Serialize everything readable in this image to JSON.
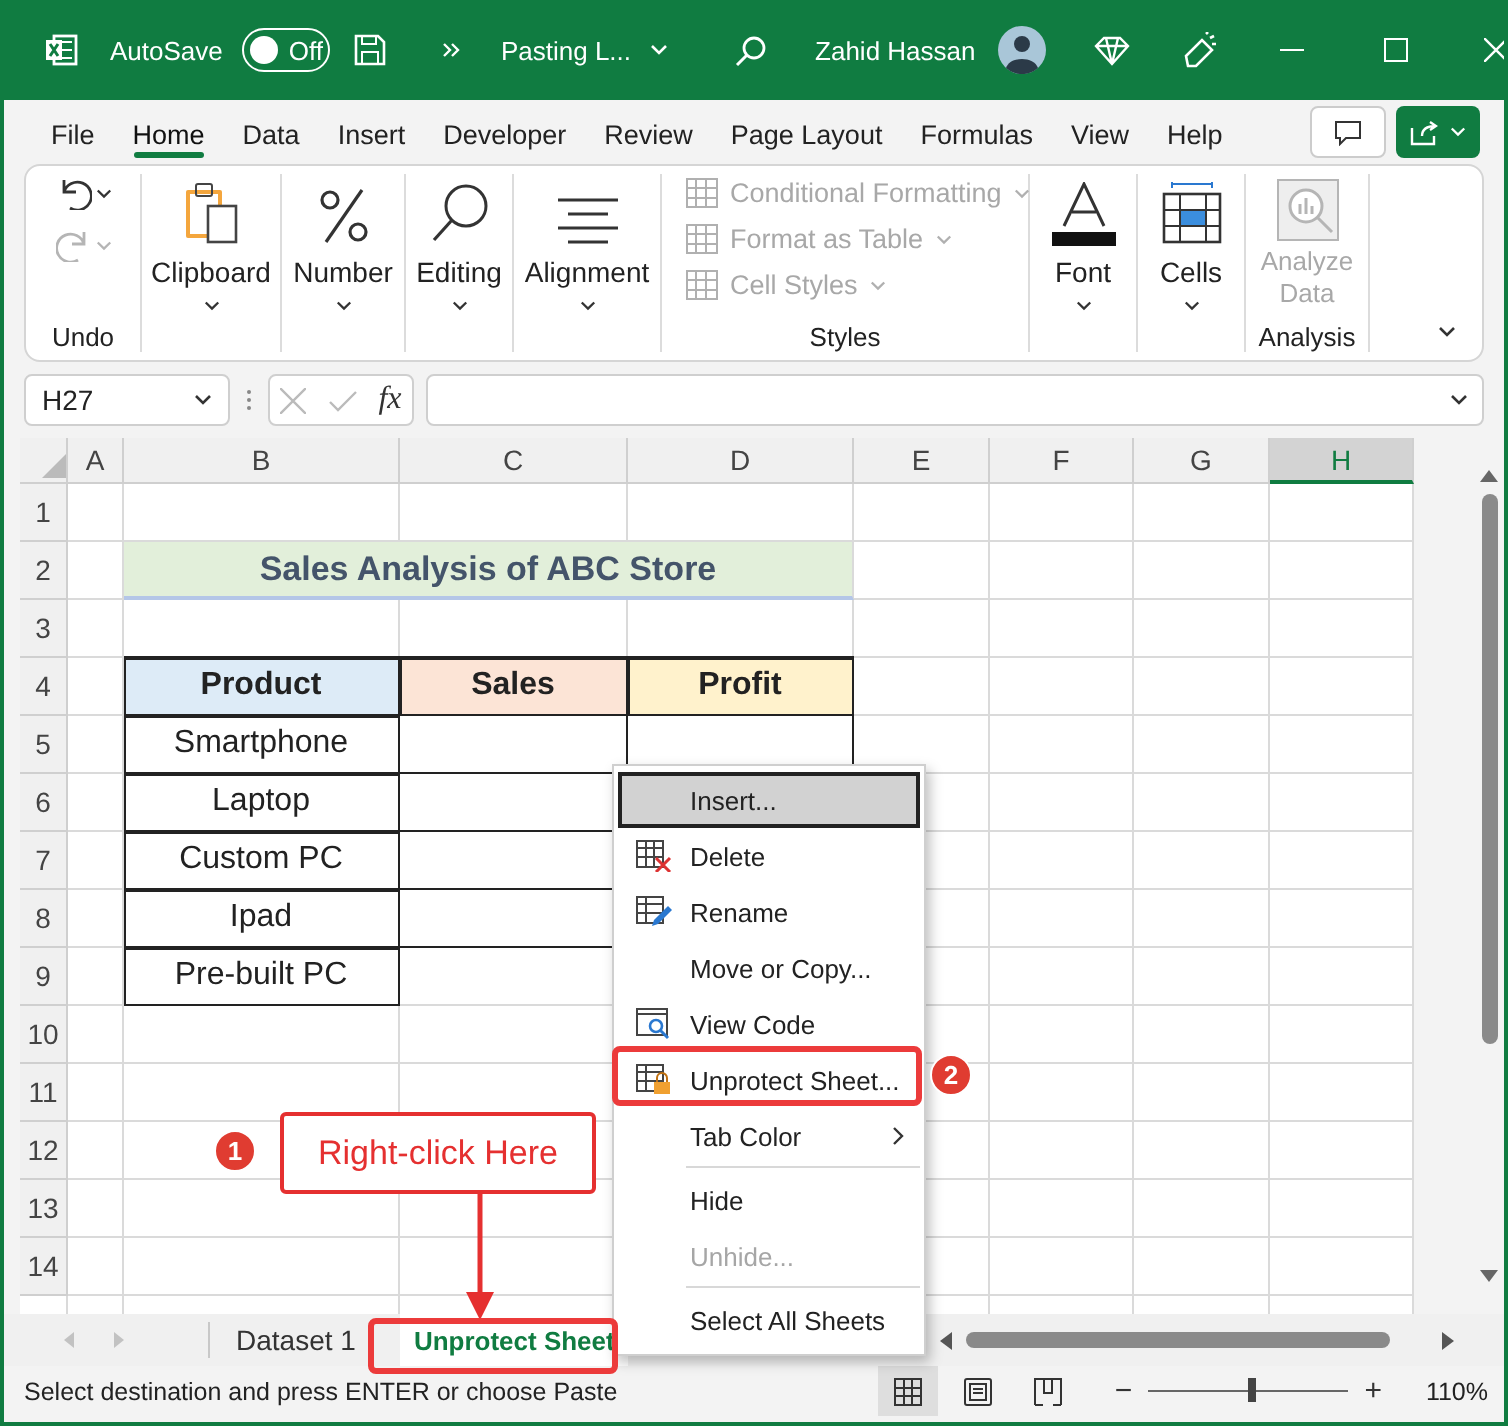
{
  "title_bar": {
    "autosave_label": "AutoSave",
    "autosave_state": "Off",
    "autosave_on": false,
    "file_name": "Pasting L...",
    "user_name": "Zahid Hassan"
  },
  "menu_tabs": [
    {
      "label": "File",
      "selected": false
    },
    {
      "label": "Home",
      "selected": true
    },
    {
      "label": "Data",
      "selected": false
    },
    {
      "label": "Insert",
      "selected": false
    },
    {
      "label": "Developer",
      "selected": false
    },
    {
      "label": "Review",
      "selected": false
    },
    {
      "label": "Page Layout",
      "selected": false
    },
    {
      "label": "Formulas",
      "selected": false
    },
    {
      "label": "View",
      "selected": false
    },
    {
      "label": "Help",
      "selected": false
    }
  ],
  "ribbon_groups": [
    {
      "kind": "undo",
      "label": "Undo"
    },
    {
      "kind": "clipboard",
      "label": "Clipboard"
    },
    {
      "kind": "number",
      "label": "Number"
    },
    {
      "kind": "editing",
      "label": "Editing"
    },
    {
      "kind": "alignment",
      "label": "Alignment"
    },
    {
      "kind": "styles",
      "label": "Styles",
      "items": [
        {
          "label": "Conditional Formatting",
          "disabled": true
        },
        {
          "label": "Format as Table",
          "disabled": true
        },
        {
          "label": "Cell Styles",
          "disabled": true
        }
      ]
    },
    {
      "kind": "font",
      "label": "Font"
    },
    {
      "kind": "cells",
      "label": "Cells"
    },
    {
      "kind": "analysis",
      "label": "Analysis",
      "button": "Analyze Data",
      "disabled": true
    }
  ],
  "formula_bar": {
    "name_box": "H27",
    "function_label": "fx"
  },
  "columns": [
    {
      "label": "A",
      "selected": false
    },
    {
      "label": "B",
      "selected": false
    },
    {
      "label": "C",
      "selected": false
    },
    {
      "label": "D",
      "selected": false
    },
    {
      "label": "E",
      "selected": false
    },
    {
      "label": "F",
      "selected": false
    },
    {
      "label": "G",
      "selected": false
    },
    {
      "label": "H",
      "selected": true
    }
  ],
  "rows": [
    "1",
    "2",
    "3",
    "4",
    "5",
    "6",
    "7",
    "8",
    "9",
    "10",
    "11",
    "12",
    "13",
    "14"
  ],
  "sheet": {
    "title": "Sales Analysis of ABC Store",
    "headers": [
      {
        "text": "Product",
        "color": "#ddebf7"
      },
      {
        "text": "Sales",
        "color": "#fce4d6"
      },
      {
        "text": "Profit",
        "color": "#fff2cc"
      }
    ],
    "products": [
      "Smartphone",
      "Laptop",
      "Custom PC",
      "Ipad",
      "Pre-built PC"
    ]
  },
  "context_menu": [
    {
      "label": "Insert...",
      "kind": "plain",
      "selected": true,
      "disabled": false,
      "submenu": false
    },
    {
      "label": "Delete",
      "kind": "delete",
      "selected": false,
      "disabled": false,
      "submenu": false
    },
    {
      "label": "Rename",
      "kind": "rename",
      "selected": false,
      "disabled": false,
      "submenu": false
    },
    {
      "label": "Move or Copy...",
      "kind": "plain",
      "selected": false,
      "disabled": false,
      "submenu": false
    },
    {
      "label": "View Code",
      "kind": "view_code",
      "selected": false,
      "disabled": false,
      "submenu": false
    },
    {
      "label": "Unprotect Sheet...",
      "kind": "unprotect",
      "selected": false,
      "disabled": false,
      "submenu": false
    },
    {
      "label": "Tab Color",
      "kind": "plain",
      "selected": false,
      "disabled": false,
      "submenu": true
    },
    {
      "kind": "separator"
    },
    {
      "label": "Hide",
      "kind": "plain",
      "selected": false,
      "disabled": false,
      "submenu": false
    },
    {
      "label": "Unhide...",
      "kind": "plain",
      "selected": false,
      "disabled": true,
      "submenu": false
    },
    {
      "kind": "separator"
    },
    {
      "label": "Select All Sheets",
      "kind": "plain",
      "selected": false,
      "disabled": false,
      "submenu": false
    }
  ],
  "callouts": [
    {
      "number": "1",
      "text": "Right-click Here"
    },
    {
      "number": "2"
    }
  ],
  "sheet_tabs": [
    {
      "label": "Dataset 1",
      "selected": false
    },
    {
      "label": "Unprotect Sheet",
      "selected": true
    }
  ],
  "status_bar": {
    "message": "Select destination and press ENTER or choose Paste",
    "view_buttons": [
      {
        "kind": "normal",
        "selected": true
      },
      {
        "kind": "page_layout",
        "selected": false
      },
      {
        "kind": "page_break",
        "selected": false
      }
    ],
    "zoom_out": "−",
    "zoom_in": "+",
    "zoom": {
      "level": 0.52
    },
    "zoom_reading": "110%"
  }
}
